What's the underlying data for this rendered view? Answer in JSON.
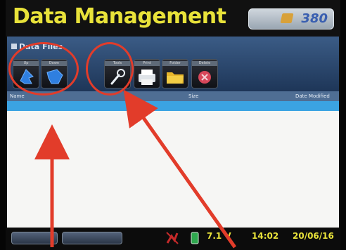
{
  "header": {
    "title": "Data Management",
    "logo_text": "380"
  },
  "data_files": {
    "title": "Data Files",
    "toolbar_buttons": [
      {
        "label": "Up",
        "icon": "blue-up-arrow-icon"
      },
      {
        "label": "Down",
        "icon": "blue-down-arrow-icon"
      },
      {
        "label": "Tools",
        "icon": "wrench-icon"
      },
      {
        "label": "Print",
        "icon": "printer-icon"
      },
      {
        "label": "Folder",
        "icon": "yellow-folder-icon"
      },
      {
        "label": "Delete",
        "icon": "red-delete-icon"
      }
    ],
    "columns": {
      "name": "Name",
      "size": "Size",
      "modified": "Date Modified"
    }
  },
  "footer": {
    "button_1": "",
    "button_2": "",
    "battery_voltage": "7.1 V",
    "time": "14:02",
    "date": "20/06/16"
  },
  "colors": {
    "title_yellow": "#e8e23a",
    "toolbar_blue": "#2b4a73",
    "selected_row": "#3ba3e2",
    "annotation_red": "#e23c2a"
  }
}
